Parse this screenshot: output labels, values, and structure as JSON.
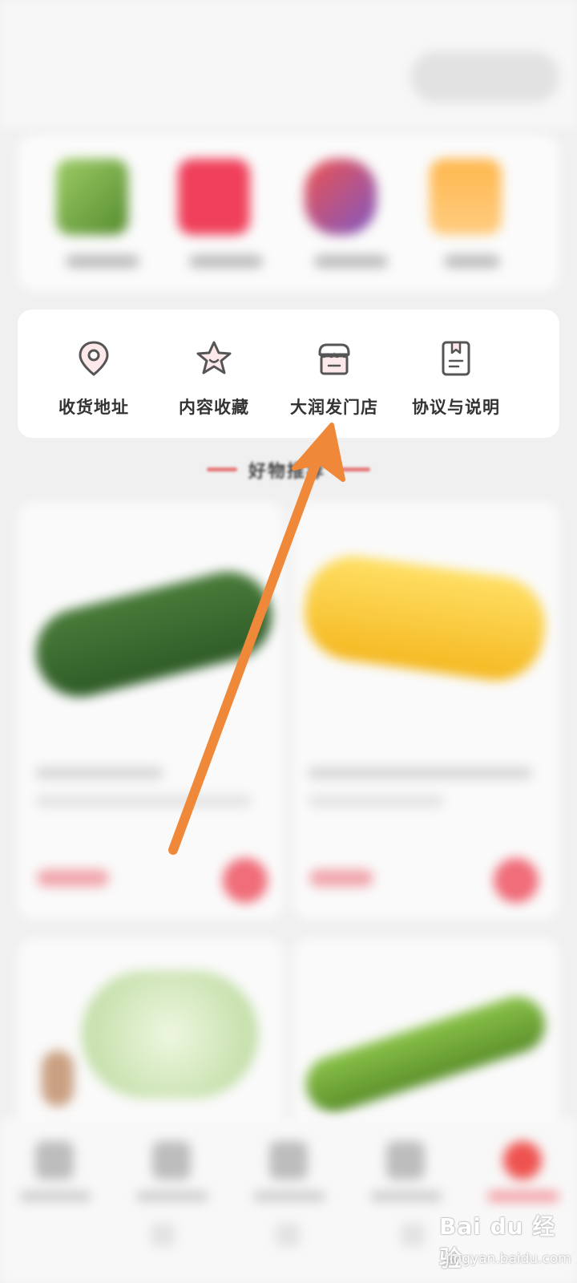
{
  "services": [
    {
      "label": "收货地址",
      "icon": "location-pin-icon"
    },
    {
      "label": "内容收藏",
      "icon": "star-icon"
    },
    {
      "label": "大润发门店",
      "icon": "store-icon"
    },
    {
      "label": "协议与说明",
      "icon": "document-icon"
    }
  ],
  "section": {
    "title": "好物推荐"
  },
  "colors": {
    "accent": "#f06d79",
    "arrow": "#f0883a",
    "icon_stroke": "#555555",
    "icon_fill": "#fde8ea"
  },
  "watermark": {
    "main": "Bai du 经验",
    "sub": "jingyan.baidu.com"
  }
}
